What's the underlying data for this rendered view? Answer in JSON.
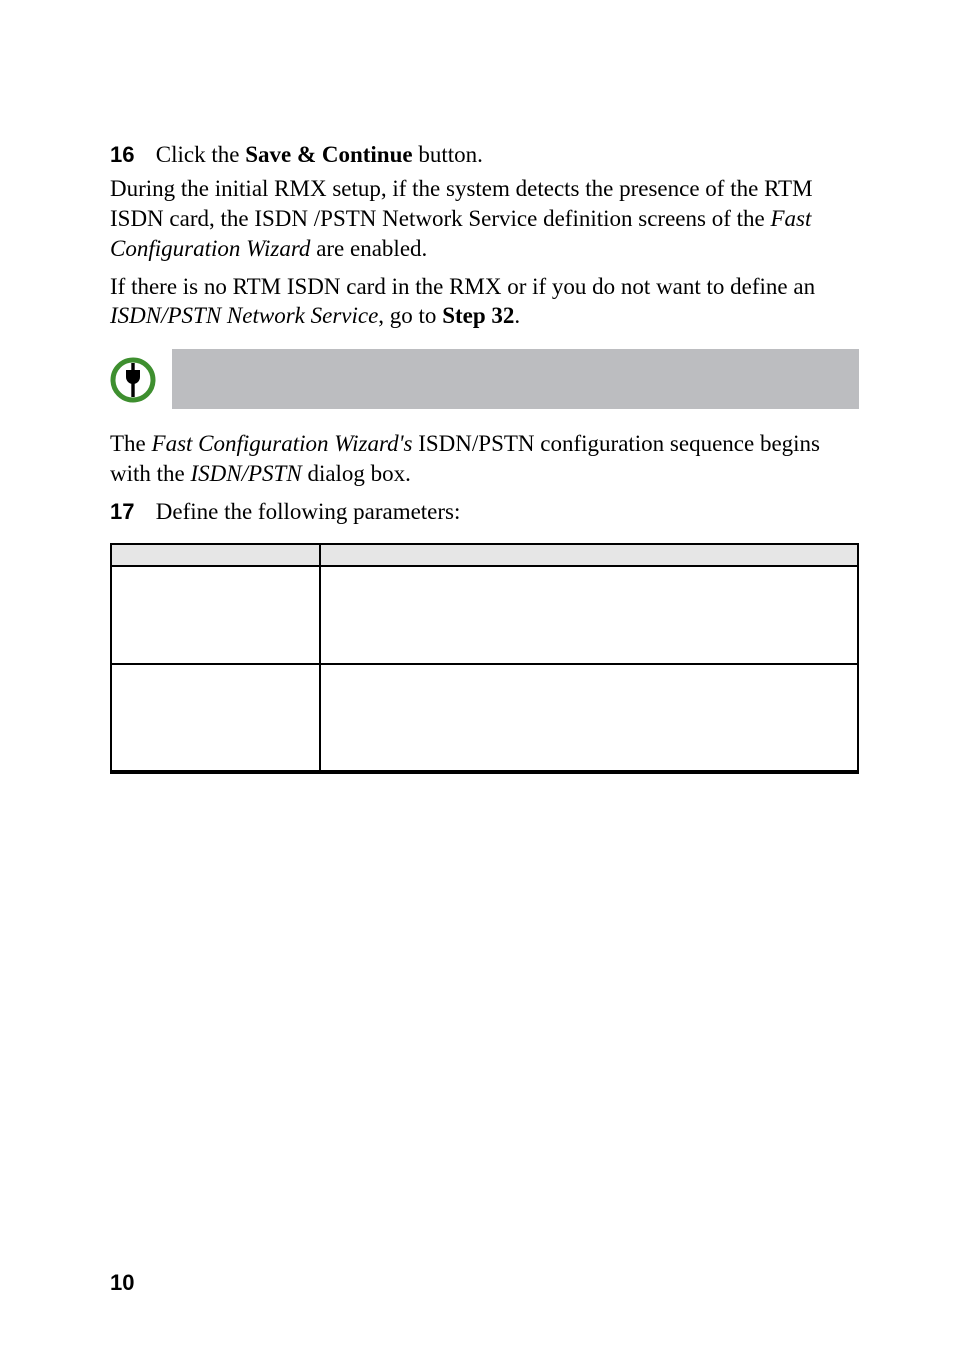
{
  "steps": {
    "s16": {
      "num": "16",
      "pre": "Click the ",
      "bold": "Save & Continue",
      "post": " button."
    },
    "s17": {
      "num": "17",
      "text": "Define the following parameters:"
    }
  },
  "para1": {
    "pre": "During the initial RMX setup, if the system detects the presence of the RTM ISDN card, the ISDN /PSTN Network Service definition screens of the ",
    "italic": "Fast Configuration Wizard",
    "post": " are enabled."
  },
  "para2": {
    "pre": "If there is no RTM ISDN card in the RMX or if you do not want to define an ",
    "italic": "ISDN/PSTN Network Service",
    "mid": ", go to ",
    "bold": "Step 32",
    "post": "."
  },
  "note": {
    "text": ""
  },
  "para3": {
    "pre": "The ",
    "italic1": "Fast Configuration Wizard's",
    "mid": " ISDN/PSTN configuration sequence begins with the ",
    "italic2": "ISDN/PSTN",
    "post": " dialog box."
  },
  "table": {
    "headers": {
      "field": "",
      "desc": ""
    },
    "rows": [
      {
        "field": "",
        "desc": ""
      },
      {
        "field": "",
        "desc": ""
      }
    ]
  },
  "pageNumber": "10",
  "chart_data": null
}
